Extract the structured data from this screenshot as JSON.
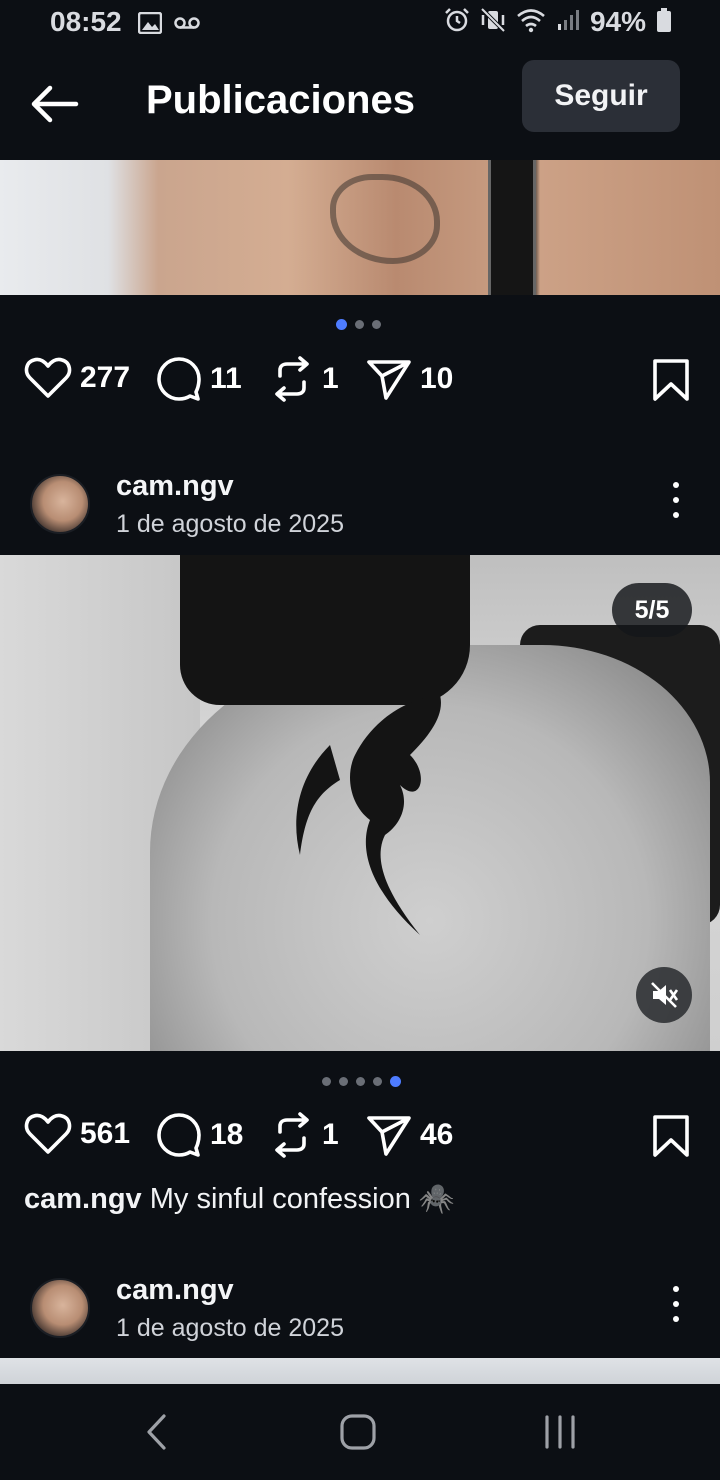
{
  "status_bar": {
    "time": "08:52",
    "battery": "94%",
    "left_icons": [
      "image-icon",
      "voicemail-icon"
    ],
    "right_icons": [
      "alarm-icon",
      "vibrate-mute-icon",
      "wifi-icon",
      "signal-icon",
      "battery-icon"
    ]
  },
  "header": {
    "title": "Publicaciones",
    "follow_label": "Seguir",
    "back_icon": "arrow-left-icon"
  },
  "post1": {
    "carousel": {
      "count": 3,
      "active": 1
    },
    "likes": "277",
    "comments": "11",
    "reposts": "1",
    "shares": "10"
  },
  "post2": {
    "username": "cam.ngv",
    "date": "1 de agosto de 2025",
    "media_counter": "5/5",
    "carousel": {
      "count": 5,
      "active": 5
    },
    "likes": "561",
    "comments": "18",
    "reposts": "1",
    "shares": "46",
    "caption_user": "cam.ngv",
    "caption_text": "My sinful confession 🕷️"
  },
  "post3": {
    "username": "cam.ngv",
    "date": "1 de agosto de 2025"
  },
  "nav": [
    "back-nav-icon",
    "home-nav-icon",
    "recents-nav-icon"
  ],
  "colors": {
    "background": "#0c0f14",
    "button_bg": "#2b2f37",
    "dot_active": "#4e7cff",
    "dot_inactive": "#6a6e76"
  }
}
